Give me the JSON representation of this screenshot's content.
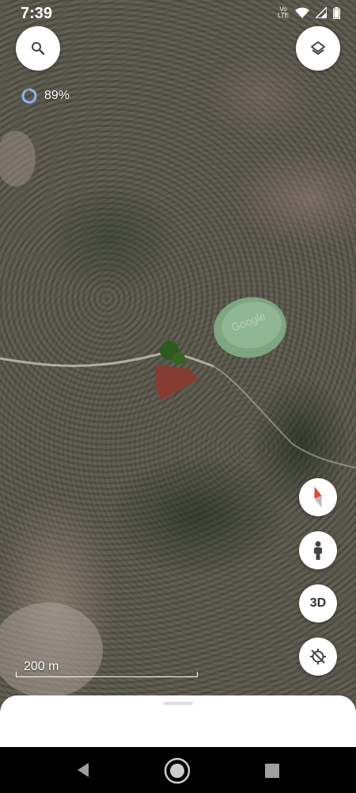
{
  "status_bar": {
    "time": "7:39",
    "network_label": "Vo LTE",
    "icons": [
      "volte-icon",
      "wifi-icon",
      "signal-icon",
      "battery-icon"
    ]
  },
  "map": {
    "type": "satellite",
    "watermark": "Google",
    "loading_percent": "89%",
    "scale_label": "200 m"
  },
  "controls": {
    "search_icon": "search-icon",
    "layers_icon": "layers-icon",
    "compass_icon": "compass-icon",
    "streetview_icon": "pegman-icon",
    "threed_label": "3D",
    "location_icon": "location-off-icon"
  },
  "navigation": {
    "buttons": [
      "back-icon",
      "home-icon",
      "recents-icon"
    ]
  },
  "colors": {
    "compass_red": "#e04a36",
    "loading_blue": "#8ab4f8"
  }
}
